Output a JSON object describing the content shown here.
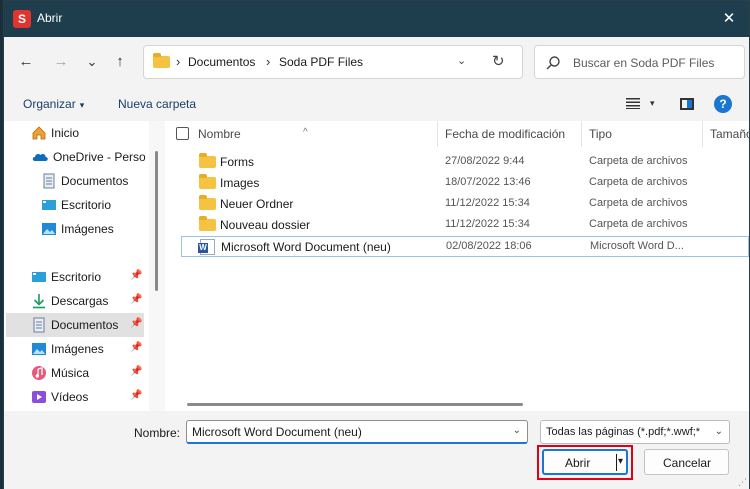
{
  "window": {
    "title": "Abrir",
    "app_icon_letter": "S",
    "close_symbol": "✕"
  },
  "nav": {
    "back": "←",
    "forward": "→",
    "recent": "⌄",
    "up": "↑"
  },
  "address": {
    "crumbs": [
      "Documentos",
      "Soda PDF Files"
    ],
    "separator": "›",
    "dropdown": "⌄",
    "refresh": "↻"
  },
  "search": {
    "placeholder": "Buscar en Soda PDF Files"
  },
  "toolbar": {
    "organize": "Organizar",
    "new_folder": "Nueva carpeta",
    "help": "?",
    "caret": "▾"
  },
  "sidebar": {
    "items": [
      {
        "label": "Inicio",
        "icon": "home-icon"
      },
      {
        "label": "OneDrive - Person",
        "icon": "cloud-icon"
      },
      {
        "label": "Documentos",
        "icon": "document-icon"
      },
      {
        "label": "Escritorio",
        "icon": "desktop-icon"
      },
      {
        "label": "Imágenes",
        "icon": "image-icon"
      },
      {
        "label": "Escritorio",
        "icon": "desktop-icon",
        "pinned": true
      },
      {
        "label": "Descargas",
        "icon": "download-icon",
        "pinned": true
      },
      {
        "label": "Documentos",
        "icon": "document-icon",
        "pinned": true,
        "active": true
      },
      {
        "label": "Imágenes",
        "icon": "image-icon",
        "pinned": true
      },
      {
        "label": "Música",
        "icon": "music-icon",
        "pinned": true
      },
      {
        "label": "Vídeos",
        "icon": "video-icon",
        "pinned": true
      }
    ],
    "pin_symbol": "📌"
  },
  "columns": {
    "name": "Nombre",
    "date": "Fecha de modificación",
    "type": "Tipo",
    "size": "Tamaño",
    "sort_caret": "^"
  },
  "files": [
    {
      "name": "Forms",
      "date": "27/08/2022 9:44",
      "type": "Carpeta de archivos",
      "kind": "folder"
    },
    {
      "name": "Images",
      "date": "18/07/2022 13:46",
      "type": "Carpeta de archivos",
      "kind": "folder"
    },
    {
      "name": "Neuer Ordner",
      "date": "11/12/2022 15:34",
      "type": "Carpeta de archivos",
      "kind": "folder"
    },
    {
      "name": "Nouveau dossier",
      "date": "11/12/2022 15:34",
      "type": "Carpeta de archivos",
      "kind": "folder"
    },
    {
      "name": "Microsoft Word Document (neu)",
      "date": "02/08/2022 18:06",
      "type": "Microsoft Word D...",
      "kind": "word",
      "selected": true
    }
  ],
  "bottom": {
    "name_label": "Nombre:",
    "name_value": "Microsoft Word Document (neu)",
    "file_type": "Todas las páginas (*.pdf;*.wwf;*",
    "open_label": "Abrir",
    "cancel_label": "Cancelar",
    "dropdown": "⌄",
    "split_caret": "▾",
    "highlight_color": "#e0001a"
  },
  "colors": {
    "titlebar": "#1e3e4e",
    "accent": "#1976d2",
    "folder": "#f5c242"
  }
}
